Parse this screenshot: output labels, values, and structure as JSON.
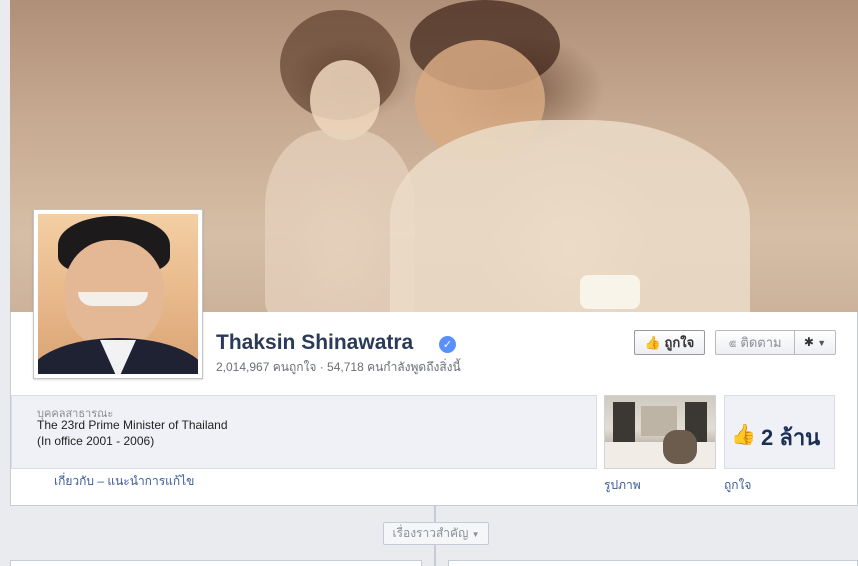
{
  "profile": {
    "name": "Thaksin Shinawatra",
    "verified_icon": "verified-check-icon",
    "stats": "2,014,967 คนถูกใจ · 54,718 คนกำลังพูดถึงสิ่งนี้"
  },
  "actions": {
    "like_label": "ถูกใจ",
    "follow_label": "ติดตาม",
    "settings_icon": "gear-icon"
  },
  "about": {
    "category": "บุคคลสาธารณะ",
    "line1": "The 23rd Prime Minister of Thailand",
    "line2": "(In office 2001 - 2006)",
    "links": "เกี่ยวกับ – แนะนำการแก้ไข"
  },
  "apps": {
    "photos_label": "รูปภาพ",
    "likes_label": "ถูกใจ",
    "likes_count": "2 ล้าน"
  },
  "timeline": {
    "highlights_label": "เรื่องราวสำคัญ"
  },
  "colors": {
    "link": "#3b5998",
    "name": "#2b3a5a",
    "verified": "#5890ff"
  }
}
